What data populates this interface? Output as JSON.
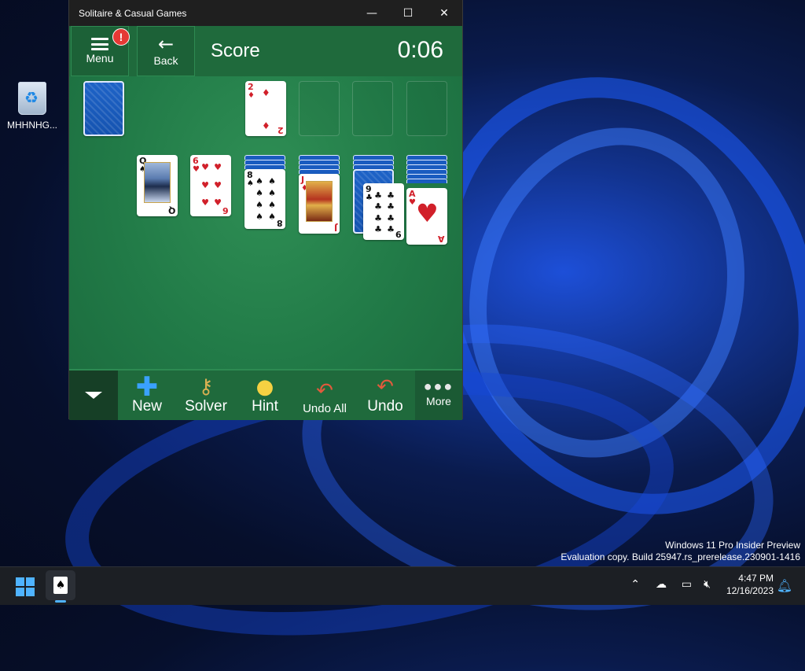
{
  "desktop": {
    "icon_label": "MHHNHG...",
    "watermark_line1": "Windows 11 Pro Insider Preview",
    "watermark_line2": "Evaluation copy. Build 25947.rs_prerelease.230901-1416"
  },
  "window": {
    "title": "Solitaire & Casual Games",
    "minimize": "—",
    "maximize": "☐",
    "close": "✕"
  },
  "game": {
    "menu_label": "Menu",
    "menu_alert": "!",
    "back_label": "Back",
    "score_label": "Score",
    "timer": "0:06",
    "waste_card": {
      "rank": "2",
      "suit": "♦"
    },
    "tableau": [
      {
        "rank": "Q",
        "suit": "♠"
      },
      {
        "rank": "6",
        "suit": "♥"
      },
      {
        "rank": "8",
        "suit": "♠"
      },
      {
        "rank": "J",
        "suit": "♦"
      },
      {
        "rank": "9",
        "suit": "♣"
      },
      {
        "rank": "A",
        "suit": "♥"
      }
    ]
  },
  "toolbar": {
    "new_label": "New",
    "solver_label": "Solver",
    "hint_label": "Hint",
    "undo_all_label": "Undo All",
    "undo_label": "Undo",
    "more_label": "More",
    "more_dots": "●●●"
  },
  "taskbar": {
    "time": "4:47 PM",
    "date": "12/16/2023"
  }
}
